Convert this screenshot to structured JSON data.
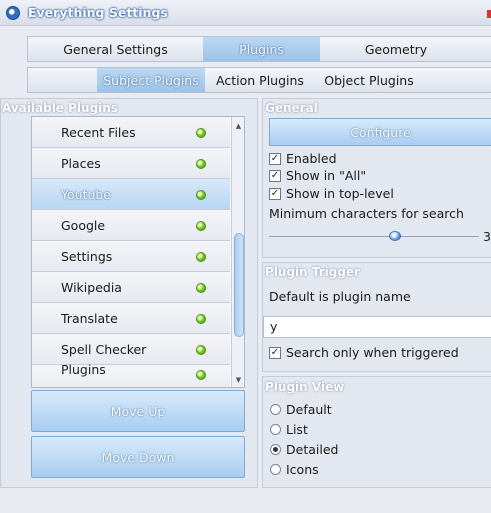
{
  "window": {
    "title": "Everything Settings"
  },
  "tabs": [
    {
      "label": "General Settings"
    },
    {
      "label": "Plugins"
    },
    {
      "label": "Geometry"
    }
  ],
  "subtabs": [
    {
      "label": "Subject Plugins"
    },
    {
      "label": "Action Plugins"
    },
    {
      "label": "Object Plugins"
    }
  ],
  "available": {
    "title": "Available Plugins",
    "items": [
      {
        "label": "Recent Files"
      },
      {
        "label": "Places"
      },
      {
        "label": "Youtube"
      },
      {
        "label": "Google"
      },
      {
        "label": "Settings"
      },
      {
        "label": "Wikipedia"
      },
      {
        "label": "Translate"
      },
      {
        "label": "Spell Checker"
      },
      {
        "label": "Plugins"
      }
    ],
    "selected_index": 2,
    "move_up": "Move Up",
    "move_down": "Move Down"
  },
  "general": {
    "title": "General",
    "configure": "Configure",
    "enabled": "Enabled",
    "show_all": "Show in \"All\"",
    "show_top": "Show in top-level",
    "min_chars_label": "Minimum characters for search",
    "min_chars_value": "3"
  },
  "trigger": {
    "title": "Plugin Trigger",
    "default_text": "Default is plugin name",
    "input_value": "y",
    "search_only": "Search only when triggered"
  },
  "view": {
    "title": "Plugin View",
    "options": [
      {
        "label": "Default"
      },
      {
        "label": "List"
      },
      {
        "label": "Detailed"
      },
      {
        "label": "Icons"
      }
    ],
    "selected": "Detailed"
  },
  "colors": {
    "accent": "#a7cdf1",
    "led_green": "#7bcf2a"
  }
}
